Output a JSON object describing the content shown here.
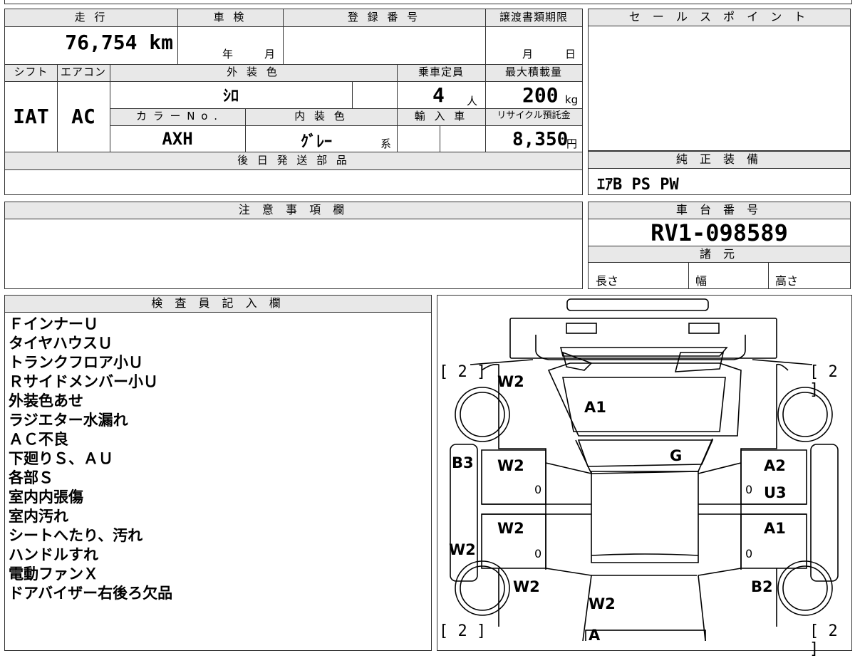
{
  "vehicle": {
    "mileage_header": "走 行",
    "mileage": "76,754 km",
    "shaken_header": "車 検",
    "shaken_year": "年",
    "shaken_month": "月",
    "registration_header": "登 録 番 号",
    "transfer_header": "譲渡書類期限",
    "transfer_month": "月",
    "transfer_day": "日",
    "shift_header": "シフト",
    "shift": "IAT",
    "ac_header": "エアコン",
    "ac": "AC",
    "exterior_color_header": "外 装 色",
    "exterior_color": "ｼﾛ",
    "capacity_header": "乗車定員",
    "capacity": "4",
    "capacity_unit": "人",
    "max_load_header": "最大積載量",
    "max_load": "200",
    "max_load_unit": "kg",
    "color_no_header": "カ ラ ー N o .",
    "color_no": "AXH",
    "interior_color_header": "内 装 色",
    "interior_color": "ｸﾞﾚｰ",
    "interior_suffix": "系",
    "import_header": "輸 入 車",
    "recycle_header": "リサイクル預託金",
    "recycle": "8,350",
    "recycle_unit": "円"
  },
  "sections": {
    "sales_point_header": "セ ー ル ス ポ イ ン ト",
    "later_parts_header": "後 日 発 送 部 品",
    "genuine_equipment_header": "純 正 装 備",
    "genuine_equipment": "ｴｱB PS PW",
    "caution_header": "注 意 事 項 欄",
    "chassis_header": "車 台 番 号",
    "chassis_number": "RV1-098589",
    "spec_header": "諸 元",
    "spec_length": "長さ",
    "spec_width": "幅",
    "spec_height": "高さ",
    "inspector_header": "検 査 員 記 入 欄"
  },
  "inspector_notes": [
    "ＦインナーＵ",
    "タイヤハウスＵ",
    "トランクフロア小Ｕ",
    "Ｒサイドメンバー小Ｕ",
    "外装色あせ",
    "ラジエター水漏れ",
    "ＡＣ不良",
    "下廻りＳ、ＡＵ",
    "各部Ｓ",
    "室内内張傷",
    "室内汚れ",
    "シートへたり、汚れ",
    "ハンドルすれ",
    "電動ファンＸ",
    "ドアバイザー右後ろ欠品"
  ],
  "diagram": {
    "tire_tl": "[ 2 ]",
    "tire_tr": "[ 2 ]",
    "tire_bl": "[ 2 ]",
    "tire_br": "[ 2 ]",
    "hood": "A1",
    "windshield": "G",
    "front_left_fender": "W2",
    "front_left_door": "W2",
    "rear_left_door": "W2",
    "rear_left_fender": "W2",
    "rear_roof": "W2",
    "left_sill_upper": "B3",
    "left_sill_lower": "W2",
    "front_right_door_a": "A2",
    "front_right_door_b": "U3",
    "rear_right_door": "A1",
    "rear_right_fender": "B2",
    "rear_bumper": "A",
    "zero1": "0",
    "zero2": "0",
    "zero3": "0",
    "zero4": "0"
  }
}
